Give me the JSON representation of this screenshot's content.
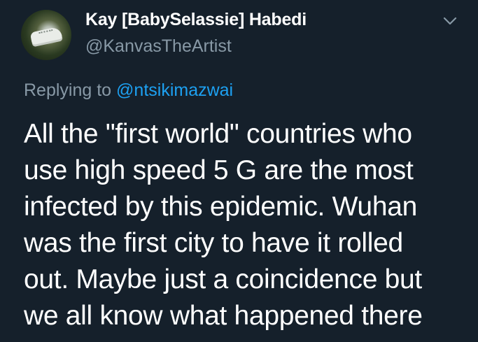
{
  "tweet": {
    "display_name": "Kay [BabySelassie] Habedi",
    "handle": "@KanvasTheArtist",
    "replying_prefix": "Replying to ",
    "replying_mention": "@ntsikimazwai",
    "body_lines": [
      "All the \"first world\" countries who",
      "use high speed 5 G are the most",
      "infected by this epidemic. Wuhan",
      "was the first city to have it rolled",
      "out. Maybe just a coincidence but",
      "we all know what happened there"
    ]
  },
  "icons": {
    "avatar": "avatar-photo-sneaker",
    "menu": "chevron-down-icon"
  },
  "colors": {
    "background": "#15202b",
    "primary_text": "#ffffff",
    "secondary_text": "#8899a6",
    "accent": "#1da1f2"
  }
}
